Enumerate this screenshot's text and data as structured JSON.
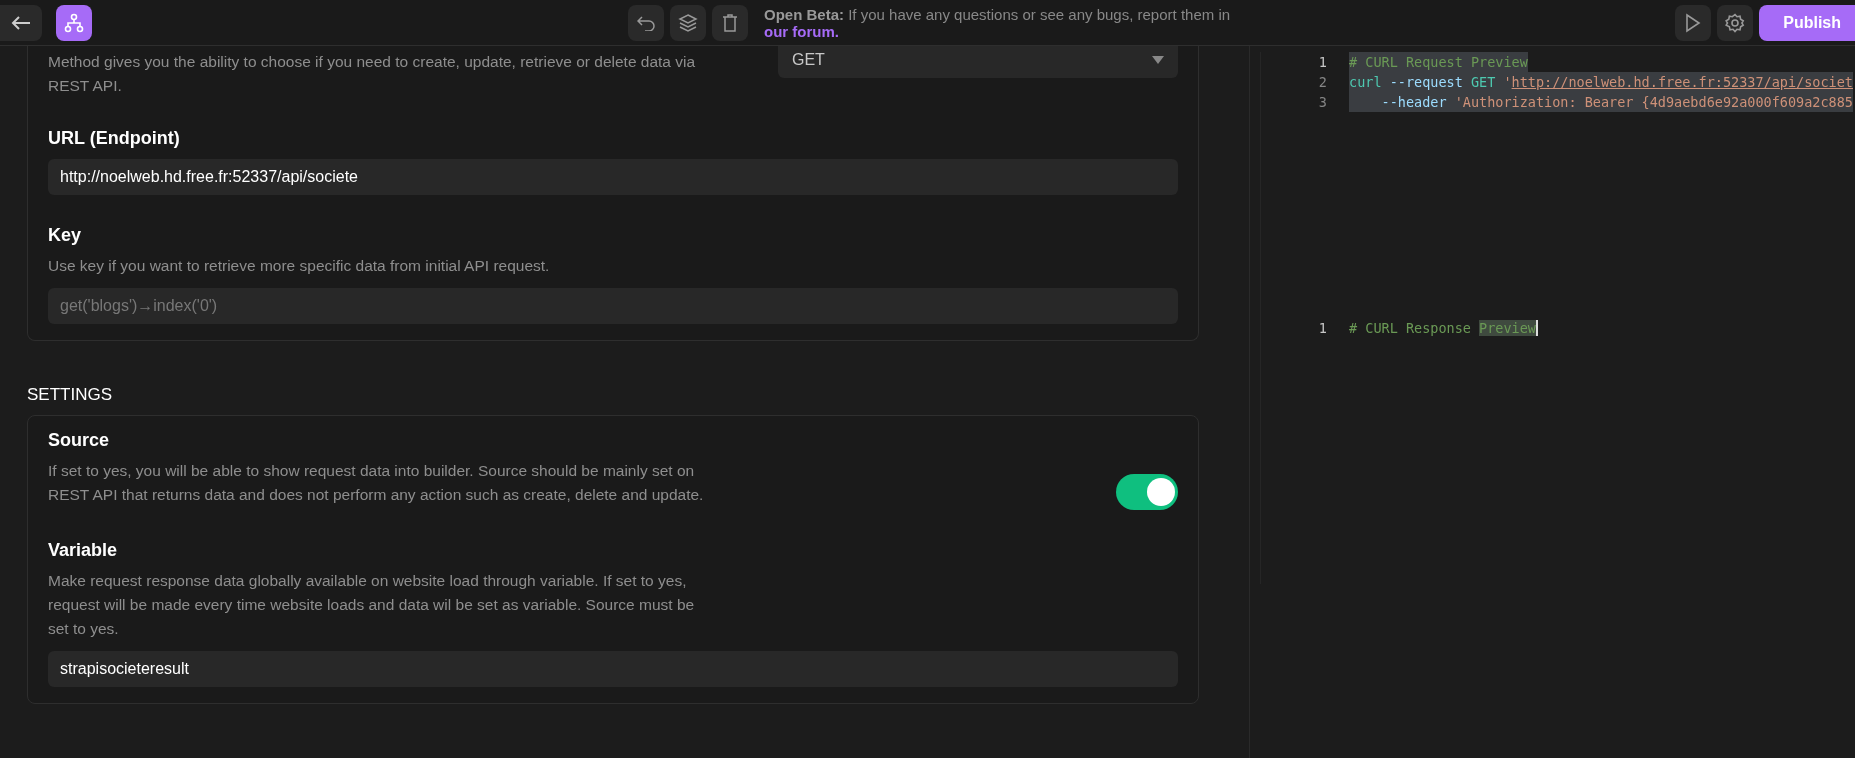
{
  "toolbar": {
    "banner": {
      "label": "Open Beta:",
      "text": "If you have any questions or see any bugs, report them in",
      "link": "our forum."
    },
    "publish": "Publish"
  },
  "request": {
    "method": {
      "description": "Method gives you the ability to choose if you need to create, update, retrieve or delete data via REST API.",
      "value": "GET"
    },
    "url": {
      "title": "URL (Endpoint)",
      "value": "http://noelweb.hd.free.fr:52337/api/societe"
    },
    "key": {
      "title": "Key",
      "description": "Use key if you want to retrieve more specific data from initial API request.",
      "placeholder": "get('blogs')→index('0')"
    }
  },
  "settings": {
    "heading": "SETTINGS",
    "source": {
      "title": "Source",
      "description": "If set to yes, you will be able to show request data into builder. Source should be mainly set on REST API that returns data and does not perform any action such as create, delete and update.",
      "on": true
    },
    "variable": {
      "title": "Variable",
      "description": "Make request response data globally available on website load through variable. If set to yes, request will be made every time website loads and data wil be set as variable. Source must be set to yes.",
      "value": "strapisocieteresult"
    }
  },
  "editors": [
    {
      "lines": [
        {
          "number": "1",
          "selected": true,
          "tokens": [
            {
              "kind": "comment",
              "text": "# CURL Request Preview"
            }
          ]
        },
        {
          "number": "2",
          "selected": true,
          "tokens": [
            {
              "kind": "keyword",
              "text": "curl "
            },
            {
              "kind": "flag",
              "text": "--request "
            },
            {
              "kind": "keyword",
              "text": "GET "
            },
            {
              "kind": "string",
              "text": "'"
            },
            {
              "kind": "link",
              "text": "http://noelweb.hd.free.fr:52337/api/societ"
            }
          ]
        },
        {
          "number": "3",
          "selected": true,
          "tokens": [
            {
              "kind": "flag",
              "text": "    --header "
            },
            {
              "kind": "string",
              "text": "'Authorization: Bearer {4d9aebd6e92a000f609a2c885"
            }
          ]
        }
      ]
    },
    {
      "lines": [
        {
          "number": "1",
          "selected": false,
          "tokens": [
            {
              "kind": "comment",
              "text": "# CURL Response "
            },
            {
              "kind": "match",
              "text": "Preview"
            }
          ]
        }
      ]
    }
  ]
}
